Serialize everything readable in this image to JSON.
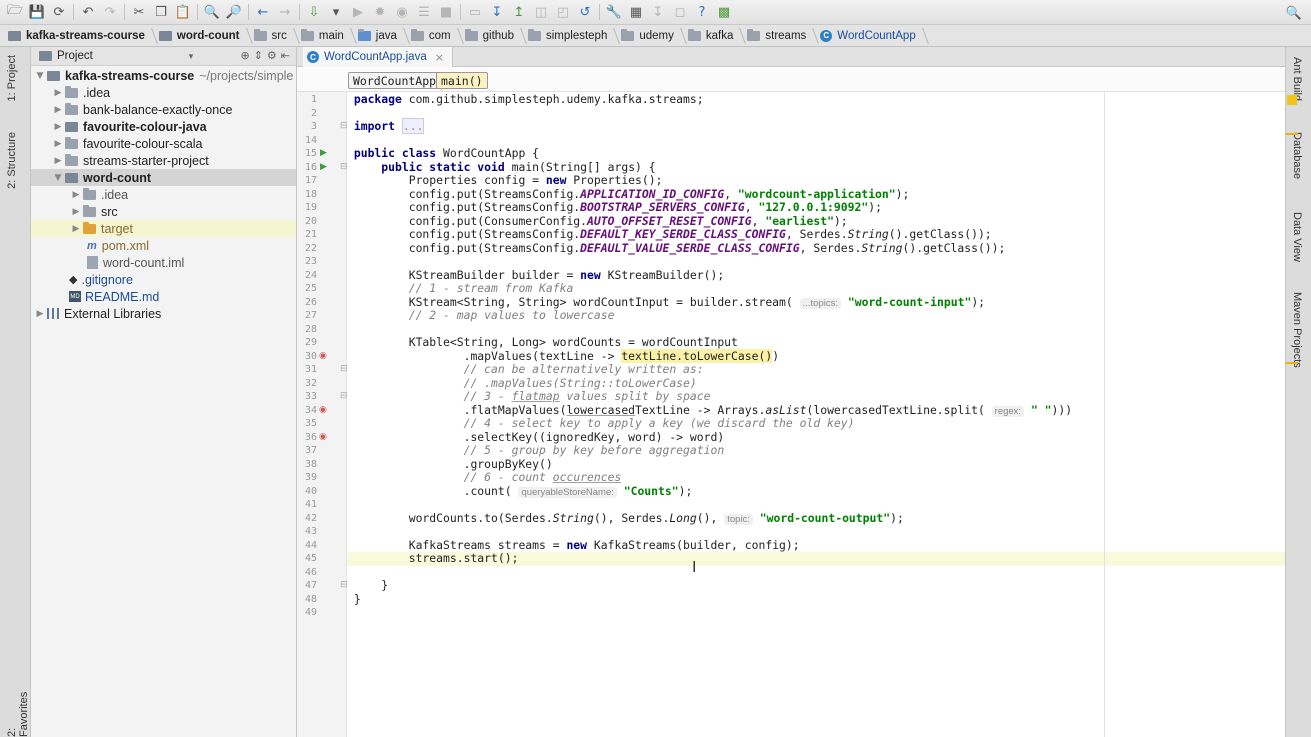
{
  "breadcrumb": [
    "kafka-streams-course",
    "word-count",
    "src",
    "main",
    "java",
    "com",
    "github",
    "simplesteph",
    "udemy",
    "kafka",
    "streams",
    "WordCountApp"
  ],
  "left_tabs": {
    "project": "1: Project",
    "structure": "2: Structure",
    "favorites": "2: Favorites"
  },
  "right_tabs": {
    "ant": "Ant Build",
    "database": "Database",
    "dataview": "Data View",
    "maven": "Maven Projects"
  },
  "project": {
    "header": "Project",
    "root": {
      "name": "kafka-streams-course",
      "path": "~/projects/simple"
    },
    "items": [
      ".idea",
      "bank-balance-exactly-once",
      "favourite-colour-java",
      "favourite-colour-scala",
      "streams-starter-project",
      "word-count",
      ".idea",
      "src",
      "target",
      "pom.xml",
      "word-count.iml",
      ".gitignore",
      "README.md",
      "External Libraries"
    ]
  },
  "editor": {
    "tab": "WordCountApp.java",
    "crumb_class": "WordCountApp",
    "crumb_method": "main()",
    "line_numbers": [
      "1",
      "2",
      "3",
      "14",
      "15",
      "16",
      "17",
      "18",
      "19",
      "20",
      "21",
      "22",
      "23",
      "24",
      "25",
      "26",
      "27",
      "28",
      "29",
      "30",
      "31",
      "32",
      "33",
      "34",
      "35",
      "36",
      "37",
      "38",
      "39",
      "40",
      "41",
      "42",
      "43",
      "44",
      "45",
      "46",
      "47",
      "48",
      "49"
    ],
    "current_line": "45"
  }
}
